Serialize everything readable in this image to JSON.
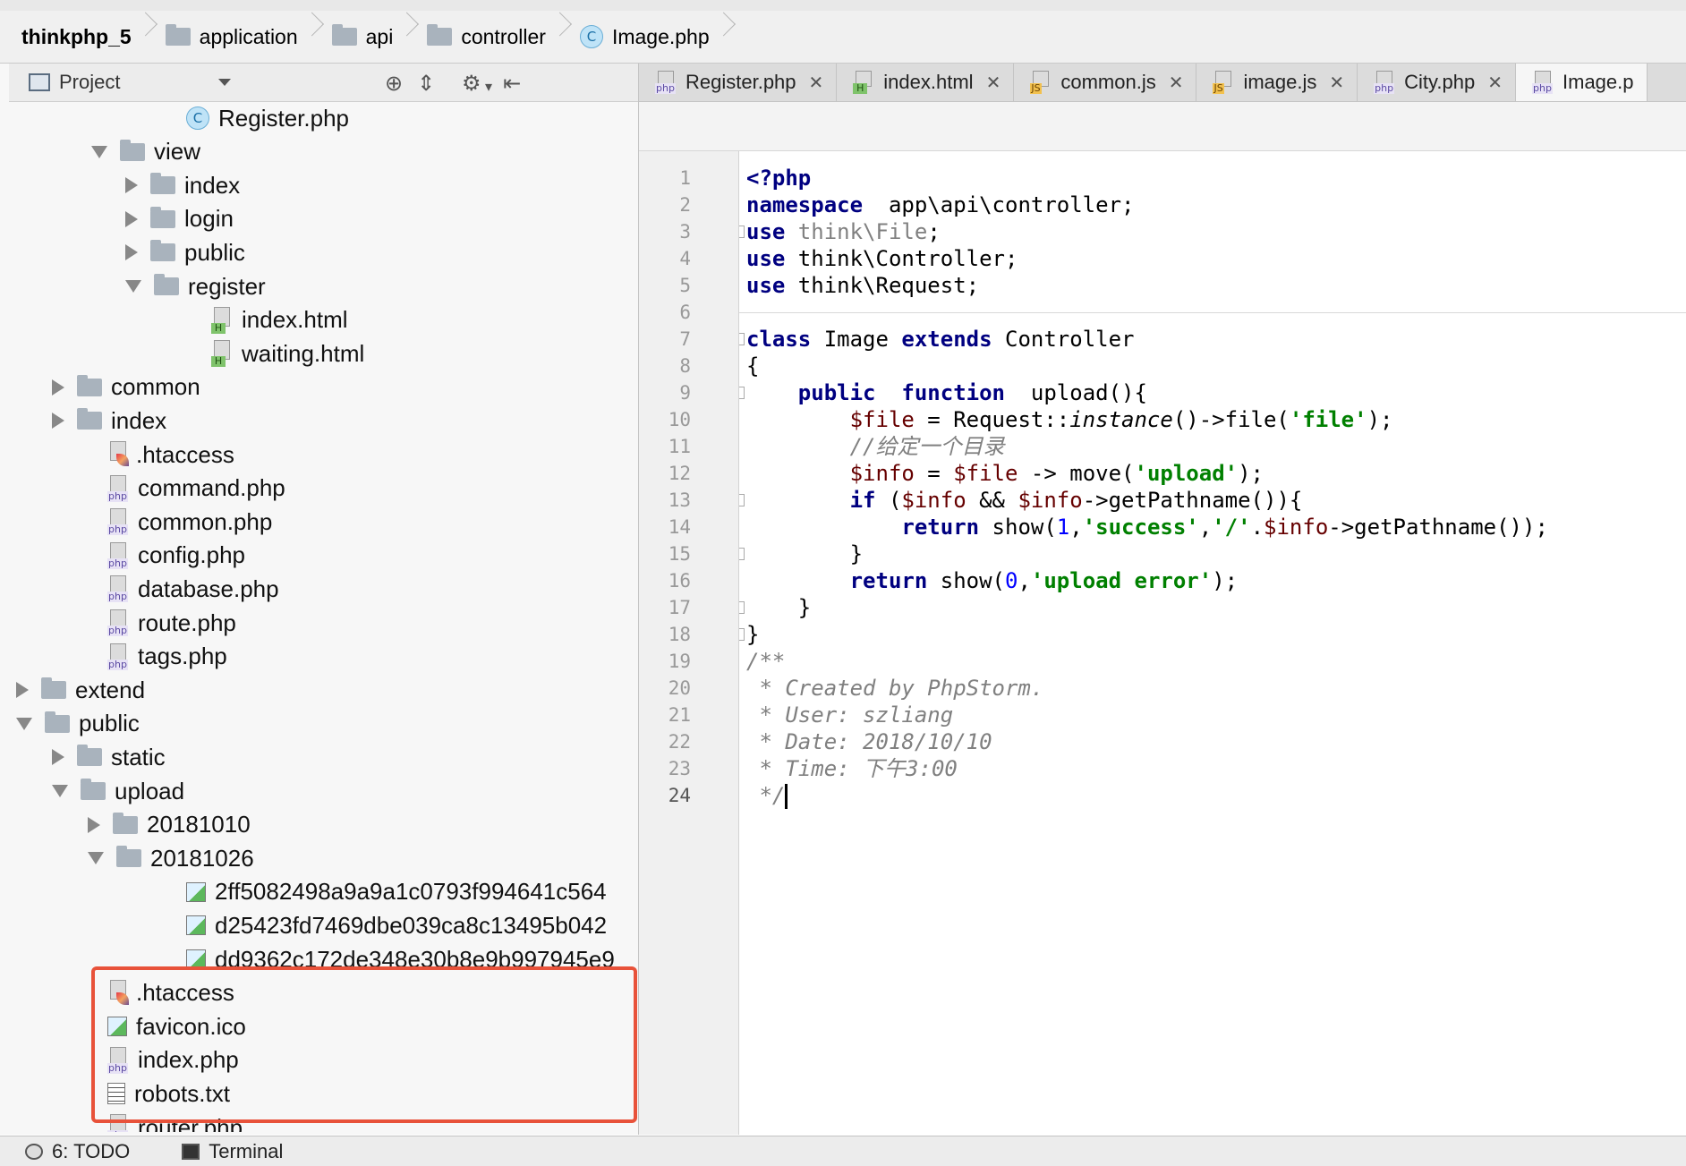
{
  "breadcrumb": {
    "items": [
      "thinkphp_5",
      "application",
      "api",
      "controller",
      "Image.php"
    ]
  },
  "sidebar": {
    "header": {
      "label": "Project"
    },
    "tree": [
      {
        "label": "Register.php",
        "type": "class",
        "expander": "none"
      },
      {
        "label": "view",
        "type": "folder",
        "expander": "expanded"
      },
      {
        "label": "index",
        "type": "folder",
        "expander": "collapsed"
      },
      {
        "label": "login",
        "type": "folder",
        "expander": "collapsed"
      },
      {
        "label": "public",
        "type": "folder",
        "expander": "collapsed"
      },
      {
        "label": "register",
        "type": "folder",
        "expander": "expanded"
      },
      {
        "label": "index.html",
        "type": "html",
        "expander": "none"
      },
      {
        "label": "waiting.html",
        "type": "html",
        "expander": "none"
      },
      {
        "label": "common",
        "type": "folder",
        "expander": "collapsed"
      },
      {
        "label": "index",
        "type": "folder",
        "expander": "collapsed"
      },
      {
        "label": ".htaccess",
        "type": "htaccess",
        "expander": "none"
      },
      {
        "label": "command.php",
        "type": "php",
        "expander": "none"
      },
      {
        "label": "common.php",
        "type": "php",
        "expander": "none"
      },
      {
        "label": "config.php",
        "type": "php",
        "expander": "none"
      },
      {
        "label": "database.php",
        "type": "php",
        "expander": "none"
      },
      {
        "label": "route.php",
        "type": "php",
        "expander": "none"
      },
      {
        "label": "tags.php",
        "type": "php",
        "expander": "none"
      },
      {
        "label": "extend",
        "type": "folder",
        "expander": "collapsed"
      },
      {
        "label": "public",
        "type": "folder",
        "expander": "expanded"
      },
      {
        "label": "static",
        "type": "folder",
        "expander": "collapsed"
      },
      {
        "label": "upload",
        "type": "folder",
        "expander": "expanded"
      },
      {
        "label": "20181010",
        "type": "folder",
        "expander": "collapsed"
      },
      {
        "label": "20181026",
        "type": "folder",
        "expander": "expanded"
      },
      {
        "label": "2ff5082498a9a9a1c0793f994641c564",
        "type": "image",
        "expander": "none"
      },
      {
        "label": "d25423fd7469dbe039ca8c13495b042",
        "type": "image",
        "expander": "none"
      },
      {
        "label": "dd9362c172de348e30b8e9b997945e9",
        "type": "image",
        "expander": "none"
      },
      {
        "label": ".htaccess",
        "type": "htaccess",
        "expander": "none"
      },
      {
        "label": "favicon.ico",
        "type": "image",
        "expander": "none"
      },
      {
        "label": "index.php",
        "type": "php",
        "expander": "none"
      },
      {
        "label": "robots.txt",
        "type": "text",
        "expander": "none"
      },
      {
        "label": "router.php",
        "type": "php",
        "expander": "none"
      }
    ]
  },
  "tabs": [
    {
      "label": "Register.php",
      "icon": "php"
    },
    {
      "label": "index.html",
      "icon": "html"
    },
    {
      "label": "common.js",
      "icon": "js"
    },
    {
      "label": "image.js",
      "icon": "js"
    },
    {
      "label": "City.php",
      "icon": "php"
    },
    {
      "label": "Image.p",
      "icon": "php",
      "active": true
    }
  ],
  "editor": {
    "line_numbers": [
      "1",
      "2",
      "3",
      "4",
      "5",
      "6",
      "7",
      "8",
      "9",
      "10",
      "11",
      "12",
      "13",
      "14",
      "15",
      "16",
      "17",
      "18",
      "19",
      "20",
      "21",
      "22",
      "23",
      "24"
    ],
    "current_line": "24",
    "lines": [
      [
        [
          "kw",
          "<?php"
        ]
      ],
      [
        [
          "kw",
          "namespace"
        ],
        [
          "",
          "  app\\api\\controller;"
        ]
      ],
      [
        [
          "kw",
          "use"
        ],
        [
          "gr",
          " think\\File"
        ],
        [
          "",
          ";"
        ]
      ],
      [
        [
          "kw",
          "use"
        ],
        [
          "",
          " think\\Controller;"
        ]
      ],
      [
        [
          "kw",
          "use"
        ],
        [
          "",
          " think\\Request;"
        ]
      ],
      [],
      [
        [
          "kw",
          "class"
        ],
        [
          "",
          " Image "
        ],
        [
          "kw",
          "extends"
        ],
        [
          "",
          " Controller"
        ]
      ],
      [
        [
          "",
          "{"
        ]
      ],
      [
        [
          "",
          "    "
        ],
        [
          "kw",
          "public"
        ],
        [
          "",
          "  "
        ],
        [
          "kw",
          "function"
        ],
        [
          "",
          "  upload(){"
        ]
      ],
      [
        [
          "",
          "        "
        ],
        [
          "var",
          "$file"
        ],
        [
          "",
          " = Request::"
        ],
        [
          "it",
          "instance"
        ],
        [
          "",
          "()->file("
        ],
        [
          "str",
          "'file'"
        ],
        [
          "",
          ");"
        ]
      ],
      [
        [
          "",
          "        "
        ],
        [
          "cm",
          "//给定一个目录"
        ]
      ],
      [
        [
          "",
          "        "
        ],
        [
          "var",
          "$info"
        ],
        [
          "",
          " = "
        ],
        [
          "var",
          "$file"
        ],
        [
          "",
          " -> move("
        ],
        [
          "str",
          "'upload'"
        ],
        [
          "",
          ");"
        ]
      ],
      [
        [
          "",
          "        "
        ],
        [
          "kw",
          "if"
        ],
        [
          "",
          " ("
        ],
        [
          "var",
          "$info"
        ],
        [
          "",
          " && "
        ],
        [
          "var",
          "$info"
        ],
        [
          "",
          "->getPathname()){"
        ]
      ],
      [
        [
          "",
          "            "
        ],
        [
          "kw",
          "return"
        ],
        [
          "",
          " show("
        ],
        [
          "num",
          "1"
        ],
        [
          "",
          ","
        ],
        [
          "str",
          "'success'"
        ],
        [
          "",
          ","
        ],
        [
          "str",
          "'/'"
        ],
        [
          "",
          "."
        ],
        [
          "var",
          "$info"
        ],
        [
          "",
          "->getPathname());"
        ]
      ],
      [
        [
          "",
          "        }"
        ]
      ],
      [
        [
          "",
          "        "
        ],
        [
          "kw",
          "return"
        ],
        [
          "",
          " show("
        ],
        [
          "num",
          "0"
        ],
        [
          "",
          ","
        ],
        [
          "str",
          "'upload error'"
        ],
        [
          "",
          ");"
        ]
      ],
      [
        [
          "",
          "    }"
        ]
      ],
      [
        [
          "",
          "}"
        ]
      ],
      [
        [
          "cm",
          "/**"
        ]
      ],
      [
        [
          "cm",
          " * Created by PhpStorm."
        ]
      ],
      [
        [
          "cm",
          " * User: szliang"
        ]
      ],
      [
        [
          "cm",
          " * Date: 2018/10/10"
        ]
      ],
      [
        [
          "cm",
          " * Time: 下午3:00"
        ]
      ],
      [
        [
          "cm",
          " */"
        ]
      ]
    ]
  },
  "bottombar": {
    "todo": "6: TODO",
    "terminal": "Terminal"
  }
}
